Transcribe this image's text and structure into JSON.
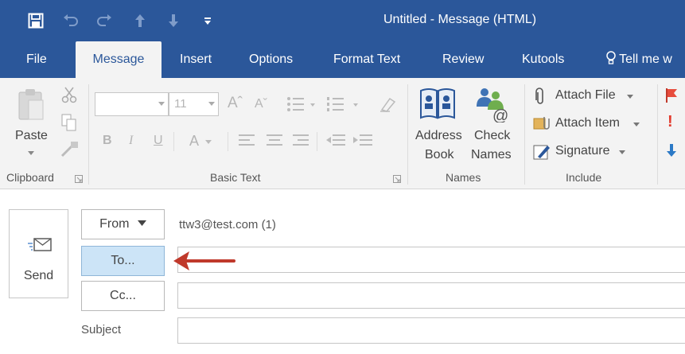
{
  "window": {
    "title": "Untitled - Message (HTML)"
  },
  "quick_access": {
    "save_icon": "save-icon",
    "undo_icon": "undo-icon",
    "redo_icon": "redo-icon",
    "up_icon": "arrow-up-icon",
    "down_icon": "arrow-down-icon",
    "customize_icon": "customize-qat-icon"
  },
  "tabs": [
    {
      "label": "File"
    },
    {
      "label": "Message"
    },
    {
      "label": "Insert"
    },
    {
      "label": "Options"
    },
    {
      "label": "Format Text"
    },
    {
      "label": "Review"
    },
    {
      "label": "Kutools"
    },
    {
      "label": "Tell me w"
    }
  ],
  "ribbon": {
    "clipboard": {
      "paste_label": "Paste",
      "group_label": "Clipboard"
    },
    "basic_text": {
      "font_size": "11",
      "group_label": "Basic Text"
    },
    "names": {
      "address_book_line1": "Address",
      "address_book_line2": "Book",
      "check_names_line1": "Check",
      "check_names_line2": "Names",
      "group_label": "Names"
    },
    "include": {
      "attach_file": "Attach File",
      "attach_item": "Attach Item",
      "signature": "Signature",
      "group_label": "Include"
    }
  },
  "compose": {
    "send_label": "Send",
    "from_label": "From",
    "from_value": "ttw3@test.com (1)",
    "to_label": "To...",
    "cc_label": "Cc...",
    "subject_label": "Subject",
    "to_value": "",
    "cc_value": "",
    "subject_value": ""
  },
  "colors": {
    "brand": "#2b579a",
    "to_button": "#cce4f7",
    "annotation_arrow": "#c0392b"
  }
}
